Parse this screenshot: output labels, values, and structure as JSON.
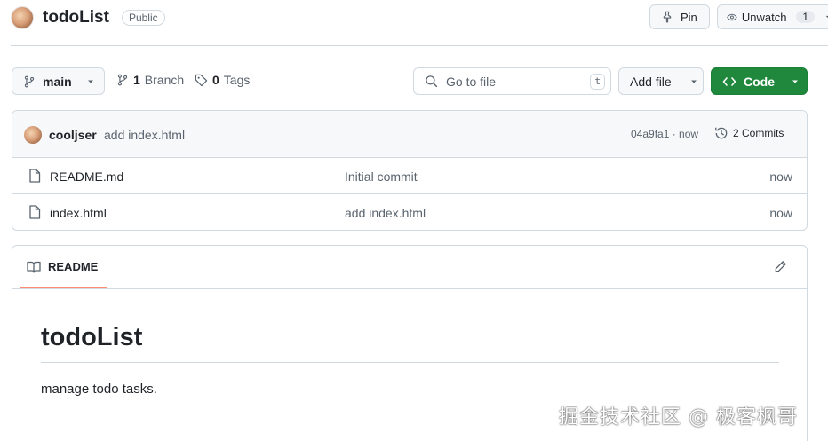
{
  "repo": {
    "name": "todoList",
    "visibility": "Public"
  },
  "actions": {
    "pin_label": "Pin",
    "watch_label": "Unwatch",
    "watch_count": "1"
  },
  "toolbar": {
    "branch": "main",
    "branch_count": "1",
    "branch_word": "Branch",
    "tag_count": "0",
    "tag_word": "Tags",
    "goto_placeholder": "Go to file",
    "goto_shortcut": "t",
    "add_file_label": "Add file",
    "code_label": "Code"
  },
  "latest_commit": {
    "author": "cooljser",
    "message": "add index.html",
    "sha_time": "04a9fa1 · now",
    "commits_label": "2 Commits"
  },
  "files": [
    {
      "name": "README.md",
      "message": "Initial commit",
      "time": "now"
    },
    {
      "name": "index.html",
      "message": "add index.html",
      "time": "now"
    }
  ],
  "readme": {
    "tab_label": "README",
    "title": "todoList",
    "body": "manage todo tasks."
  },
  "watermark": "掘金技术社区 @ 极客枫哥",
  "colors": {
    "accent_green": "#1f883d",
    "tab_underline": "#fd8c73",
    "border": "#d1d9e0",
    "muted": "#59636e"
  },
  "icons": [
    "pin-icon",
    "eye-icon",
    "branch-icon",
    "tag-icon",
    "search-icon",
    "code-icon",
    "history-icon",
    "file-icon",
    "book-icon",
    "pencil-icon",
    "caret-down-icon"
  ]
}
